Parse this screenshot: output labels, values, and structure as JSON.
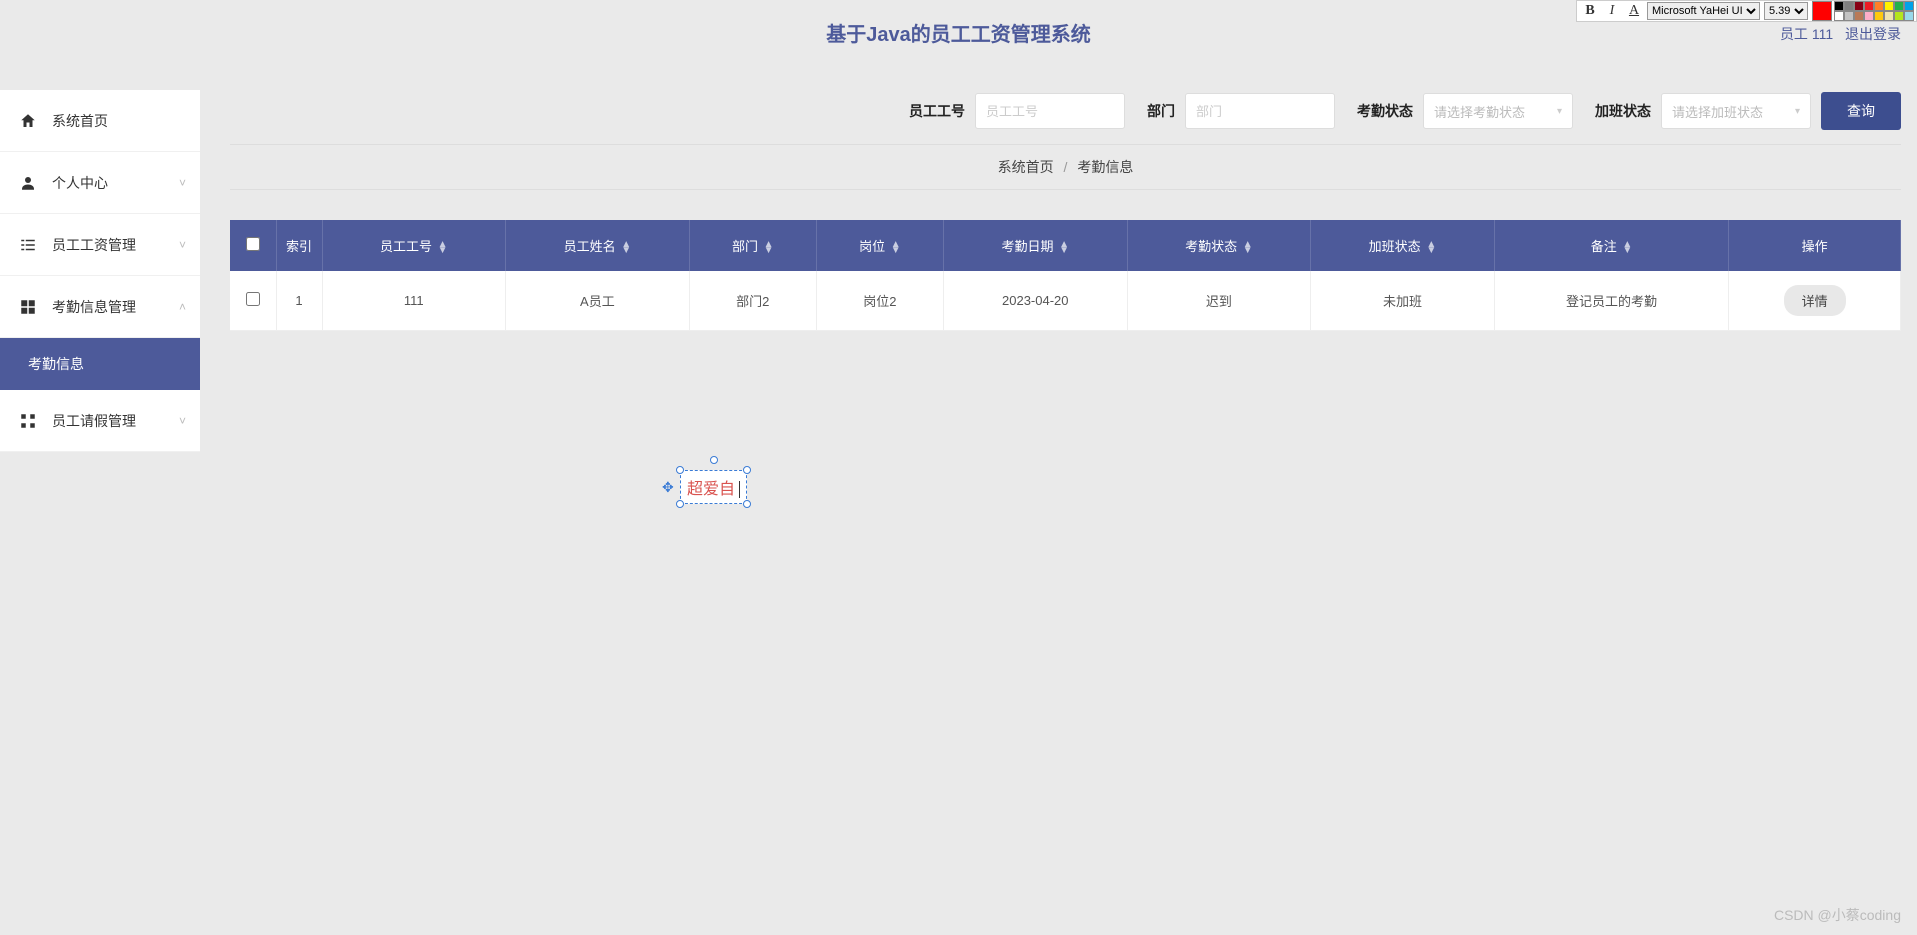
{
  "header": {
    "title": "基于Java的员工工资管理系统",
    "user_label": "员工 111",
    "logout": "退出登录"
  },
  "editor": {
    "bold": "B",
    "italic": "I",
    "underline": "A",
    "font": "Microsoft YaHei UI",
    "size": "5.39",
    "palette": [
      "#000000",
      "#7f7f7f",
      "#880015",
      "#ed1c24",
      "#ff7f27",
      "#fff200",
      "#22b14c",
      "#00a2e8",
      "#ffffff",
      "#c3c3c3",
      "#b97a57",
      "#ffaec9",
      "#ffc90e",
      "#efe4b0",
      "#b5e61d",
      "#99d9ea"
    ]
  },
  "sidebar": {
    "items": [
      {
        "label": "系统首页",
        "icon": "home",
        "expandable": false
      },
      {
        "label": "个人中心",
        "icon": "user",
        "expandable": true,
        "open": false
      },
      {
        "label": "员工工资管理",
        "icon": "list",
        "expandable": true,
        "open": false
      },
      {
        "label": "考勤信息管理",
        "icon": "grid",
        "expandable": true,
        "open": true
      },
      {
        "label": "员工请假管理",
        "icon": "apps",
        "expandable": true,
        "open": false
      }
    ],
    "sub_active": "考勤信息"
  },
  "filters": {
    "emp_id_label": "员工工号",
    "emp_id_ph": "员工工号",
    "dept_label": "部门",
    "dept_ph": "部门",
    "att_label": "考勤状态",
    "att_ph": "请选择考勤状态",
    "ot_label": "加班状态",
    "ot_ph": "请选择加班状态",
    "search": "查询"
  },
  "breadcrumb": {
    "home": "系统首页",
    "sep": "/",
    "current": "考勤信息"
  },
  "table": {
    "headers": [
      "索引",
      "员工工号",
      "员工姓名",
      "部门",
      "岗位",
      "考勤日期",
      "考勤状态",
      "加班状态",
      "备注",
      "操作"
    ],
    "rows": [
      {
        "idx": "1",
        "emp_id": "111",
        "name": "A员工",
        "dept": "部门2",
        "post": "岗位2",
        "date": "2023-04-20",
        "att": "迟到",
        "ot": "未加班",
        "note": "登记员工的考勤"
      }
    ],
    "detail_btn": "详情"
  },
  "float_text": "超爱自",
  "watermark": "CSDN @小蔡coding"
}
